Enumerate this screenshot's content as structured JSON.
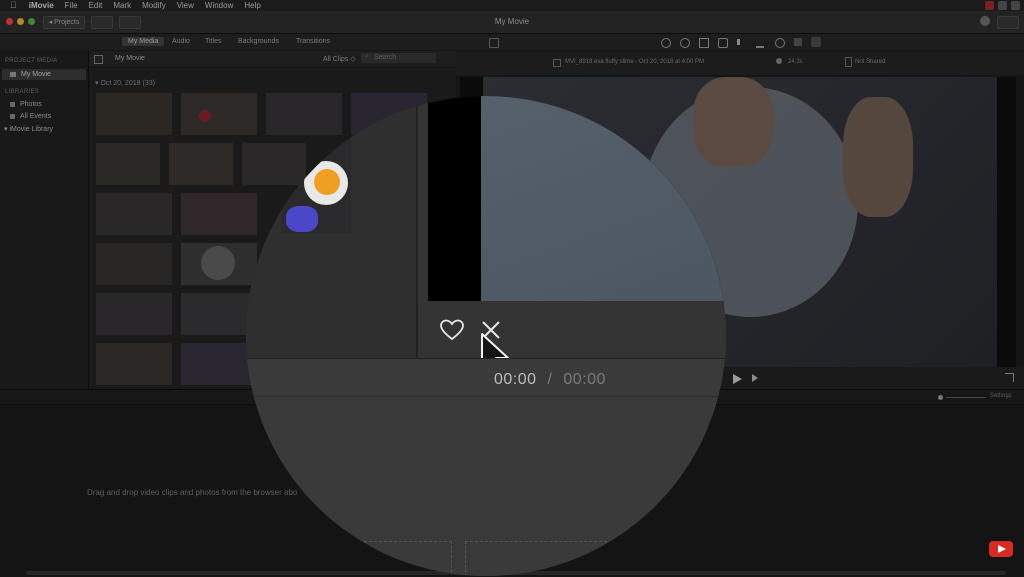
{
  "menubar": {
    "apple": "",
    "items": [
      "iMovie",
      "File",
      "Edit",
      "Mark",
      "Modify",
      "View",
      "Window",
      "Help"
    ]
  },
  "titlebar": {
    "title": "My Movie",
    "projects_button": "◂ Projects"
  },
  "browser_tabs": [
    "My Media",
    "Audio",
    "Titles",
    "Backgrounds",
    "Transitions"
  ],
  "active_tab": "My Media",
  "sidebar": {
    "project_media_header": "PROJECT MEDIA",
    "project_item": "My Movie",
    "libraries_header": "LIBRARIES",
    "library_items": [
      "Photos",
      "All Events",
      "▾ iMovie Library"
    ]
  },
  "browser": {
    "title": "My Movie",
    "filter": "All Clips ◇",
    "search_placeholder": "Search",
    "date_header": "▾ Oct 20, 2018  (33)"
  },
  "viewer": {
    "clip_info": "MVI_8918 eva fluffy slime - Oct 20, 2018 at 4:00 PM",
    "zoom": "24.3s",
    "share_status": "Not Shared"
  },
  "playback": {
    "current_time": "00:00",
    "separator": "/",
    "total_time": "00:00"
  },
  "timeline": {
    "hint": "Drag and drop video clips and photos from the browser abo",
    "settings_label": "Settings"
  },
  "colors": {
    "background": "#151515",
    "panel": "#1b1b1b",
    "lens": "#353535",
    "accent_red": "#d62a22"
  },
  "icons": [
    "apple-icon",
    "heart-icon",
    "reject-icon",
    "cursor-icon",
    "play-icon",
    "next-icon",
    "fullscreen-icon",
    "youtube-icon"
  ]
}
